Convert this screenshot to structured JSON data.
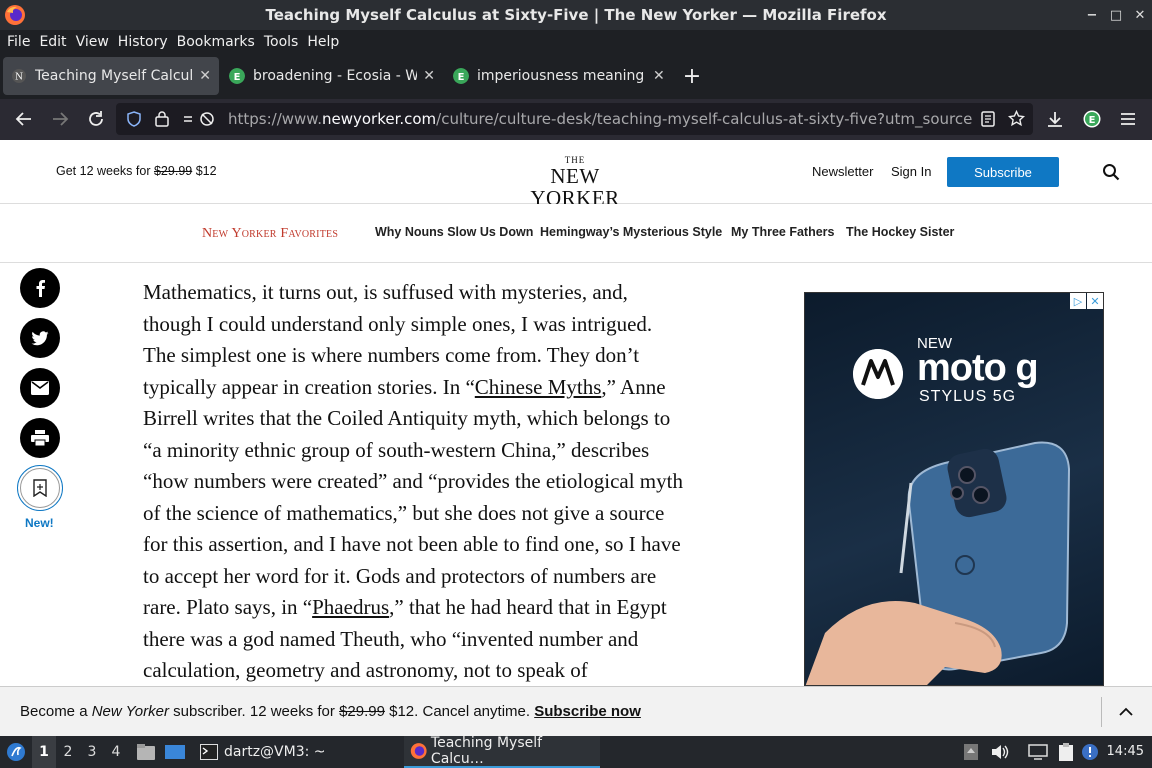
{
  "window": {
    "title": "Teaching Myself Calculus at Sixty-Five | The New Yorker — Mozilla Firefox"
  },
  "menu": [
    "File",
    "Edit",
    "View",
    "History",
    "Bookmarks",
    "Tools",
    "Help"
  ],
  "tabs": [
    {
      "label": "Teaching Myself Calculus",
      "active": true
    },
    {
      "label": "broadening - Ecosia - We",
      "active": false
    },
    {
      "label": "imperiousness meaning -",
      "active": false
    }
  ],
  "url": {
    "prefix": "https://www.",
    "host": "newyorker.com",
    "path": "/culture/culture-desk/teaching-myself-calculus-at-sixty-five?utm_source=pocket"
  },
  "header": {
    "promo_prefix": "Get 12 weeks for",
    "promo_old_price": "$29.99",
    "promo_new_price": "$12",
    "logo_the": "THE",
    "logo_name": "NEW YORKER",
    "newsletter": "Newsletter",
    "sign_in": "Sign In",
    "subscribe": "Subscribe"
  },
  "favorites": {
    "title": "New Yorker Favorites",
    "links": [
      "Why Nouns Slow Us Down",
      "Hemingway’s Mysterious Style",
      "My Three Fathers",
      "The Hockey Sister"
    ]
  },
  "share": {
    "new_label": "New!"
  },
  "article": {
    "p1": "Mathematics, it turns out, is suffused with mysteries, and, though I could understand only simple ones, I was intrigued. The simplest one is where numbers come from. They don’t typically appear in creation stories. In “",
    "link1": "Chinese Myths",
    "p2": ",” Anne Birrell writes that the Coiled Antiquity myth, which belongs to “a minority ethnic group of south-western China,” describes “how numbers were created” and “provides the etiological myth of the science of mathematics,” but she does not give a source for this assertion, and I have not been able to find one, so I have to accept her word for it. Gods and protectors of numbers are rare. Plato says, in “",
    "link2": "Phaedrus",
    "p3": ",” that he had heard that in Egypt there was a god named Theuth, who “invented number and calculation, geometry and astronomy, not to speak of"
  },
  "ad": {
    "new": "NEW",
    "brand": "moto g",
    "model": "STYLUS 5G"
  },
  "banner": {
    "prefix": "Become a ",
    "publication": "New Yorker",
    "middle": " subscriber. 12 weeks for ",
    "old_price": "$29.99",
    "suffix": " $12. Cancel anytime. ",
    "link": "Subscribe now"
  },
  "taskbar": {
    "workspaces": [
      "1",
      "2",
      "3",
      "4"
    ],
    "terminal": "dartz@VM3: ~",
    "browser": "Teaching Myself Calcu…",
    "clock": "14:45"
  }
}
